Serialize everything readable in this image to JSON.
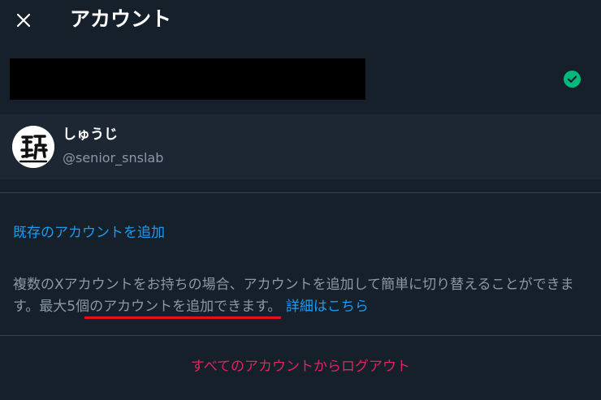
{
  "header": {
    "title": "アカウント"
  },
  "accounts": [
    {
      "redacted": true,
      "selected": true,
      "status_color": "#00ba7c"
    },
    {
      "display_name": "しゅうじ",
      "handle": "@senior_snslab"
    }
  ],
  "actions": {
    "add_existing": "既存のアカウントを追加",
    "logout_all": "すべてのアカウントからログアウト"
  },
  "info": {
    "text_part1": "複数のXアカウントをお持ちの場合、アカウントを追加して簡単に切り替えることができます。最大5個のアカウントを追加できます。",
    "details_link": "詳細はこちら"
  },
  "colors": {
    "background": "#15202b",
    "accent": "#1d9bf0",
    "danger": "#e0245e",
    "highlight_mark": "#e3101f"
  }
}
